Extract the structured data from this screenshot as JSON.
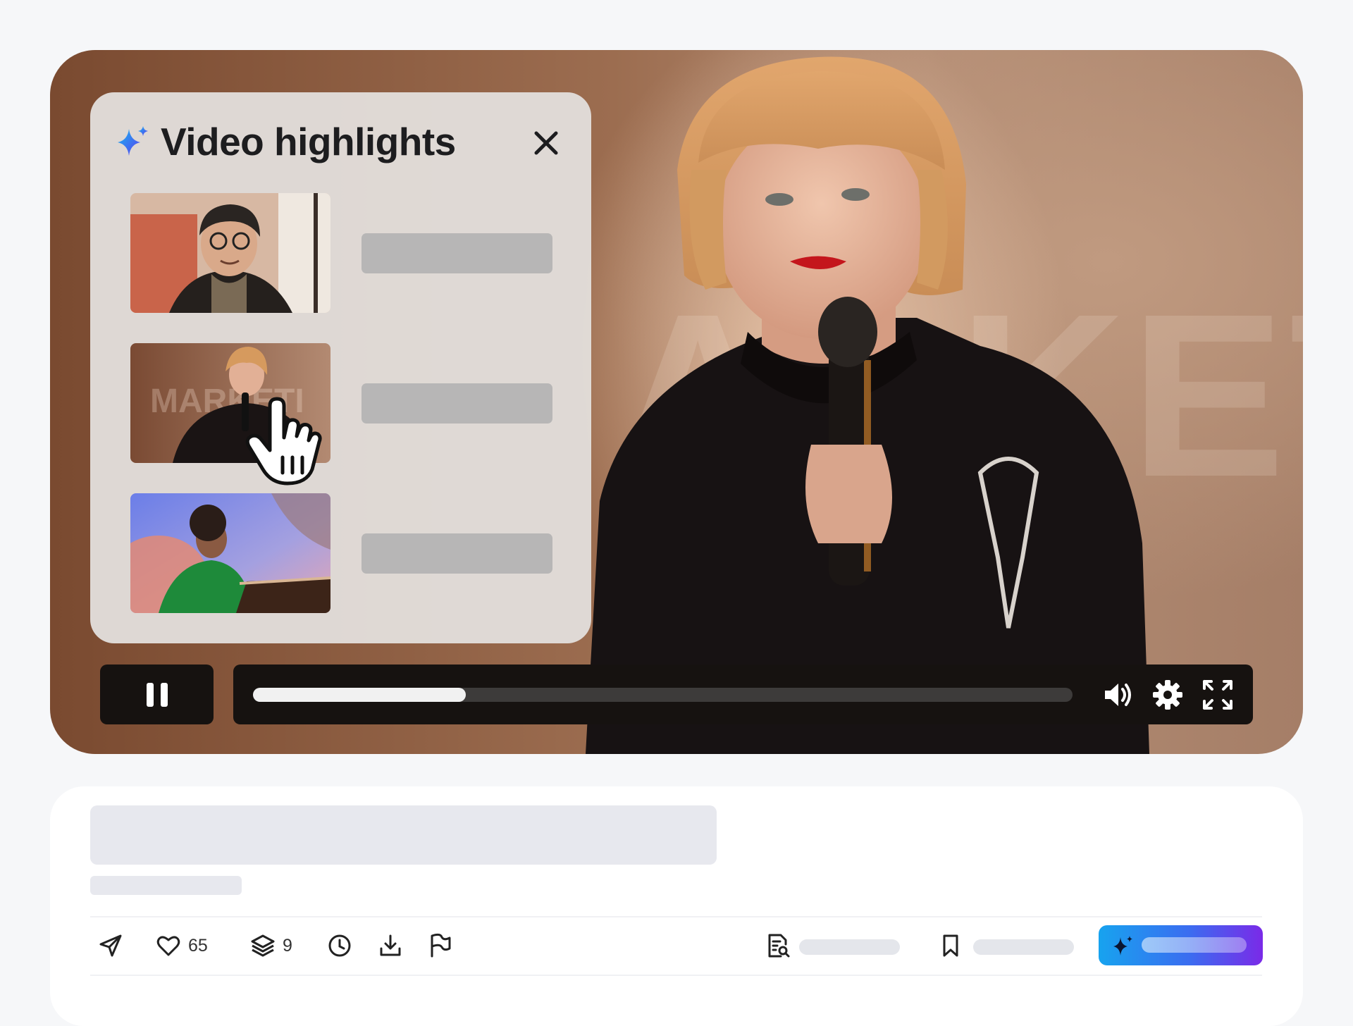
{
  "panel": {
    "title": "Video highlights",
    "close_icon": "close-icon",
    "spark_icon": "sparkle-icon",
    "items": [
      {
        "thumbnail": "man-with-glasses-thumbnail"
      },
      {
        "thumbnail": "woman-with-microphone-thumbnail",
        "thumb_text": "MARKETI"
      },
      {
        "thumbnail": "woman-at-podium-thumbnail"
      }
    ]
  },
  "video": {
    "background_text": "ARKETI",
    "progress": 0.26
  },
  "controls": {
    "pause_icon": "pause-icon",
    "volume_icon": "volume-icon",
    "settings_icon": "gear-icon",
    "fullscreen_icon": "fullscreen-icon"
  },
  "actions": {
    "likes": "65",
    "layers": "9"
  },
  "colors": {
    "accent_gradient_start": "#17a3ef",
    "accent_gradient_end": "#7a2ae8",
    "control_bg": "#161210"
  }
}
